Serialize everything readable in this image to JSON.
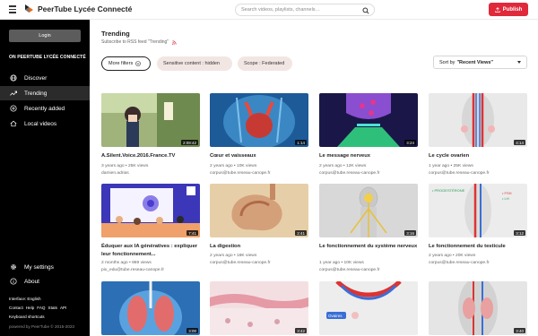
{
  "header": {
    "brand": "PeerTube Lycée Connecté",
    "search_placeholder": "Search videos, playlists, channels…",
    "publish_label": "Publish"
  },
  "sidebar": {
    "login_label": "Login",
    "heading": "ON PEERTUBE LYCÉE CONNECTÉ",
    "items": [
      {
        "label": "Discover",
        "icon": "globe-icon"
      },
      {
        "label": "Trending",
        "icon": "trending-icon",
        "active": true
      },
      {
        "label": "Recently added",
        "icon": "plus-circle-icon"
      },
      {
        "label": "Local videos",
        "icon": "home-icon"
      }
    ],
    "my_settings": "My settings",
    "about": "About",
    "interface_label": "Interface: English",
    "links": [
      "Contact",
      "Help",
      "FAQ",
      "Stats",
      "API"
    ],
    "keyboard_shortcuts": "Keyboard shortcuts",
    "powered_by": "powered by PeerTube © 2015-2023"
  },
  "main": {
    "title": "Trending",
    "rss_text": "Subscribe to RSS feed \"Trending\"",
    "more_filters": "More filters",
    "sensitive_chip": "Sensitive content : hidden",
    "scope_chip": "Scope : Federated",
    "sort_label": "Sort by",
    "sort_value": "\"Recent Views\""
  },
  "colors": {
    "accent": "#e0293b",
    "sidebar_bg": "#000000",
    "chip_bg": "#f2e6e3"
  },
  "videos": [
    {
      "title": "A.Silent.Voice.2016.France.TV",
      "meta": "3 years ago • 25K views",
      "account": "damien.adrias",
      "duration": "2:09:42"
    },
    {
      "title": "Cœur et vaisseaux",
      "meta": "2 years ago • 10K views",
      "account": "corpus@tube.reseau-canope.fr",
      "duration": "1:14"
    },
    {
      "title": "Le message nerveux",
      "meta": "2 years ago • 12K views",
      "account": "corpus@tube.reseau-canope.fr",
      "duration": "3:24"
    },
    {
      "title": "Le cycle ovarien",
      "meta": "1 year ago • 25K views",
      "account": "corpus@tube.reseau-canope.fr",
      "duration": "4:14"
    },
    {
      "title": "Éduquer aux IA génératives : expliquer leur fonctionnement...",
      "meta": "2 months ago • 869 views",
      "account": "pix_edu@tube.reseau-canope.fr",
      "duration": "7:41"
    },
    {
      "title": "La digestion",
      "meta": "2 years ago • 18K views",
      "account": "corpus@tube.reseau-canope.fr",
      "duration": "2:41"
    },
    {
      "title": "Le fonctionnement du système nerveux",
      "meta": "1 year ago • 10K views",
      "account": "corpus@tube.reseau-canope.fr",
      "duration": "3:16"
    },
    {
      "title": "Le fonctionnement du testicule",
      "meta": "2 years ago • 20K views",
      "account": "corpus@tube.reseau-canope.fr",
      "duration": "3:12"
    },
    {
      "title": "",
      "meta": "",
      "account": "",
      "duration": "3:00"
    },
    {
      "title": "",
      "meta": "",
      "account": "",
      "duration": "3:42"
    },
    {
      "title": "",
      "meta": "",
      "account": "",
      "duration": ""
    },
    {
      "title": "",
      "meta": "",
      "account": "",
      "duration": "3:40"
    }
  ],
  "thumb_labels": {
    "ovarian_left": "• PROGESTÉRONE",
    "testicle_fsh": "• FSH",
    "testicle_lh": "• LH",
    "ovaires": "Ovaires"
  }
}
